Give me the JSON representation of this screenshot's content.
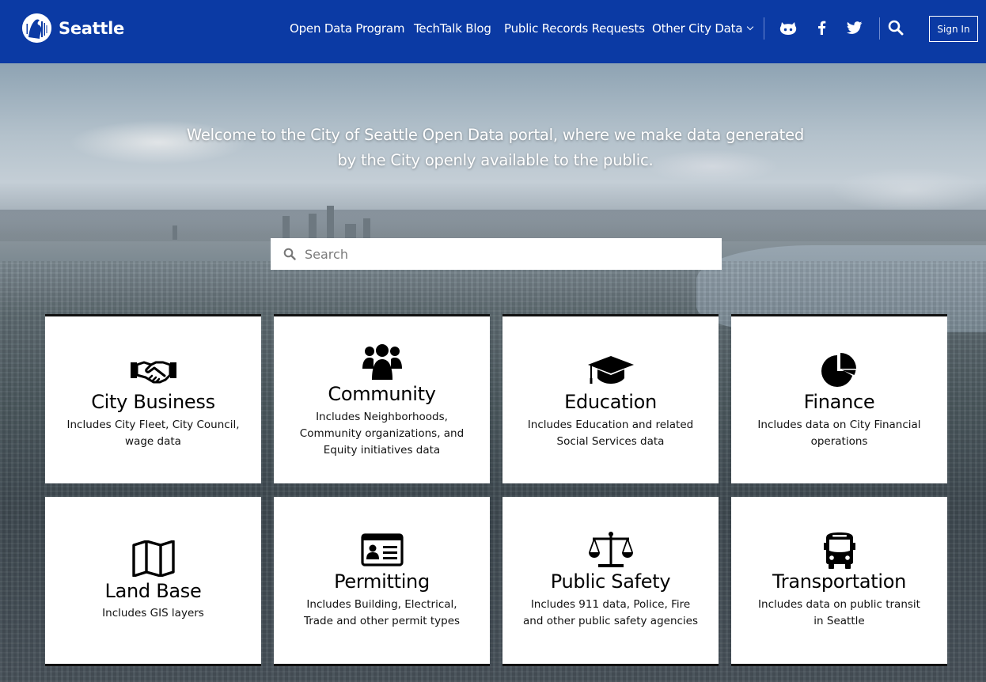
{
  "header": {
    "brand": "Seattle",
    "nav": [
      {
        "label": "Open Data Program"
      },
      {
        "label": "TechTalk Blog"
      },
      {
        "label": "Public Records Requests"
      },
      {
        "label": "Other City Data"
      }
    ],
    "social_icons": [
      "github-icon",
      "facebook-icon",
      "twitter-icon"
    ],
    "search_icon": "search-icon",
    "sign_in": "Sign In",
    "colors": {
      "background": "#0b3aa4",
      "text": "#ffffff"
    }
  },
  "hero": {
    "welcome_line1": "Welcome to the City of Seattle Open Data portal, where we make data generated",
    "welcome_line2": "by the City openly available to the public.",
    "search_placeholder": "Search"
  },
  "categories": [
    {
      "title": "City Business",
      "description": "Includes City Fleet, City Council, wage data",
      "icon": "handshake-icon"
    },
    {
      "title": "Community",
      "description": "Includes Neighborhoods, Community organizations, and Equity initiatives data",
      "icon": "group-icon"
    },
    {
      "title": "Education",
      "description": "Includes Education and related Social Services data",
      "icon": "graduation-cap-icon"
    },
    {
      "title": "Finance",
      "description": "Includes data on City Financial operations",
      "icon": "pie-chart-icon"
    },
    {
      "title": "Land Base",
      "description": "Includes GIS layers",
      "icon": "map-icon"
    },
    {
      "title": "Permitting",
      "description": "Includes Building, Electrical, Trade and other permit types",
      "icon": "id-card-icon"
    },
    {
      "title": "Public Safety",
      "description": "Includes 911 data, Police, Fire and other public safety agencies",
      "icon": "scales-icon"
    },
    {
      "title": "Transportation",
      "description": "Includes data on public transit in Seattle",
      "icon": "bus-icon"
    }
  ]
}
